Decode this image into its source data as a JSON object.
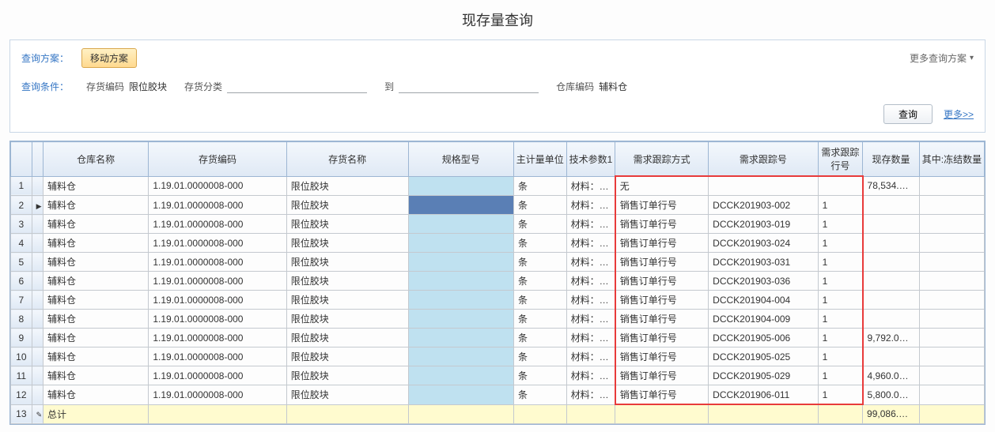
{
  "page_title": "现存量查询",
  "panel": {
    "scheme_label": "查询方案：",
    "scheme_button": "移动方案",
    "more_scheme": "更多查询方案",
    "cond_label": "查询条件：",
    "cond_inventory_code_label": "存货编码",
    "cond_inventory_code_value": "限位胶块",
    "cond_inventory_cat_label": "存货分类",
    "cond_inventory_cat_value": "",
    "cond_to_label": "到",
    "cond_to_value": "",
    "cond_wh_label": "仓库编码",
    "cond_wh_value": "辅料仓",
    "query_btn": "查询",
    "more_link": "更多>>"
  },
  "grid": {
    "headers": {
      "warehouse": "仓库名称",
      "code": "存货编码",
      "name": "存货名称",
      "spec": "规格型号",
      "unit": "主计量单位",
      "tech": "技术参数1",
      "track_mode": "需求跟踪方式",
      "track_no": "需求跟踪号",
      "track_line": "需求跟踪行号",
      "qty": "现存数量",
      "frozen": "其中:冻结数量"
    },
    "rows": [
      {
        "n": "1",
        "wh": "辅料仓",
        "code": "1.19.01.0000008-000",
        "name": "限位胶块",
        "spec": "",
        "unit": "条",
        "tech": "材料：K…",
        "mode": "无",
        "tno": "",
        "tl": "",
        "qty": "78,534.…",
        "fz": ""
      },
      {
        "n": "2",
        "wh": "辅料仓",
        "code": "1.19.01.0000008-000",
        "name": "限位胶块",
        "spec": "",
        "unit": "条",
        "tech": "材料：K…",
        "mode": "销售订单行号",
        "tno": "DCCK201903-002",
        "tl": "1",
        "qty": "",
        "fz": "",
        "sel": true,
        "arrow": true
      },
      {
        "n": "3",
        "wh": "辅料仓",
        "code": "1.19.01.0000008-000",
        "name": "限位胶块",
        "spec": "",
        "unit": "条",
        "tech": "材料：K…",
        "mode": "销售订单行号",
        "tno": "DCCK201903-019",
        "tl": "1",
        "qty": "",
        "fz": ""
      },
      {
        "n": "4",
        "wh": "辅料仓",
        "code": "1.19.01.0000008-000",
        "name": "限位胶块",
        "spec": "",
        "unit": "条",
        "tech": "材料：K…",
        "mode": "销售订单行号",
        "tno": "DCCK201903-024",
        "tl": "1",
        "qty": "",
        "fz": ""
      },
      {
        "n": "5",
        "wh": "辅料仓",
        "code": "1.19.01.0000008-000",
        "name": "限位胶块",
        "spec": "",
        "unit": "条",
        "tech": "材料：K…",
        "mode": "销售订单行号",
        "tno": "DCCK201903-031",
        "tl": "1",
        "qty": "",
        "fz": ""
      },
      {
        "n": "6",
        "wh": "辅料仓",
        "code": "1.19.01.0000008-000",
        "name": "限位胶块",
        "spec": "",
        "unit": "条",
        "tech": "材料：K…",
        "mode": "销售订单行号",
        "tno": "DCCK201903-036",
        "tl": "1",
        "qty": "",
        "fz": ""
      },
      {
        "n": "7",
        "wh": "辅料仓",
        "code": "1.19.01.0000008-000",
        "name": "限位胶块",
        "spec": "",
        "unit": "条",
        "tech": "材料：K…",
        "mode": "销售订单行号",
        "tno": "DCCK201904-004",
        "tl": "1",
        "qty": "",
        "fz": ""
      },
      {
        "n": "8",
        "wh": "辅料仓",
        "code": "1.19.01.0000008-000",
        "name": "限位胶块",
        "spec": "",
        "unit": "条",
        "tech": "材料：K…",
        "mode": "销售订单行号",
        "tno": "DCCK201904-009",
        "tl": "1",
        "qty": "",
        "fz": ""
      },
      {
        "n": "9",
        "wh": "辅料仓",
        "code": "1.19.01.0000008-000",
        "name": "限位胶块",
        "spec": "",
        "unit": "条",
        "tech": "材料：K…",
        "mode": "销售订单行号",
        "tno": "DCCK201905-006",
        "tl": "1",
        "qty": "9,792.0…",
        "fz": ""
      },
      {
        "n": "10",
        "wh": "辅料仓",
        "code": "1.19.01.0000008-000",
        "name": "限位胶块",
        "spec": "",
        "unit": "条",
        "tech": "材料：K…",
        "mode": "销售订单行号",
        "tno": "DCCK201905-025",
        "tl": "1",
        "qty": "",
        "fz": ""
      },
      {
        "n": "11",
        "wh": "辅料仓",
        "code": "1.19.01.0000008-000",
        "name": "限位胶块",
        "spec": "",
        "unit": "条",
        "tech": "材料：K…",
        "mode": "销售订单行号",
        "tno": "DCCK201905-029",
        "tl": "1",
        "qty": "4,960.0…",
        "fz": ""
      },
      {
        "n": "12",
        "wh": "辅料仓",
        "code": "1.19.01.0000008-000",
        "name": "限位胶块",
        "spec": "",
        "unit": "条",
        "tech": "材料：K…",
        "mode": "销售订单行号",
        "tno": "DCCK201906-011",
        "tl": "1",
        "qty": "5,800.0…",
        "fz": ""
      }
    ],
    "total": {
      "n": "13",
      "label": "总计",
      "qty": "99,086.…"
    }
  }
}
